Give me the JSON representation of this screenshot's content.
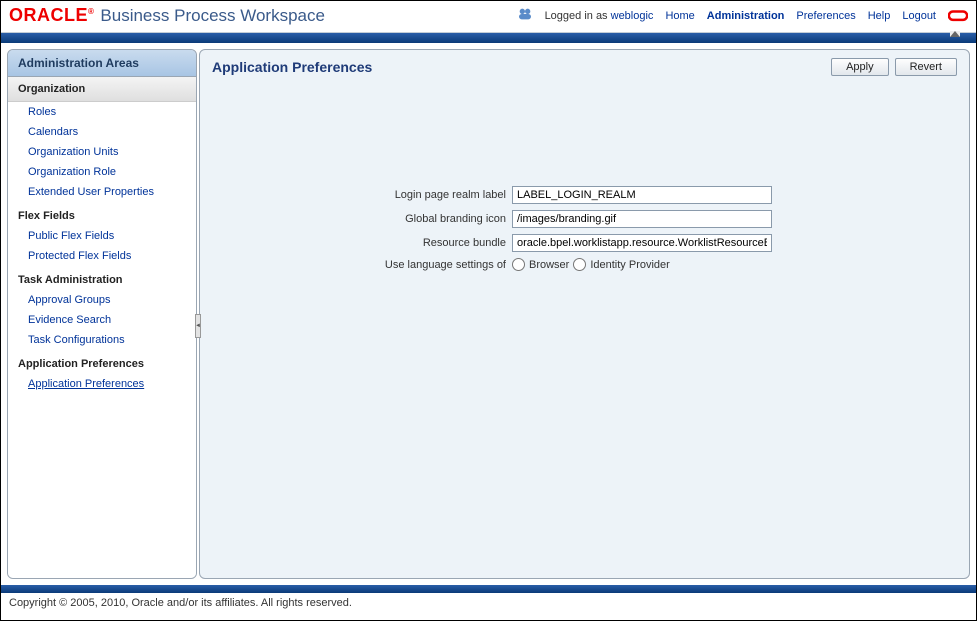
{
  "brand": {
    "oracle": "ORACLE",
    "reg": "®",
    "title": "Business Process Workspace"
  },
  "header": {
    "logged_in_prefix": "Logged in as ",
    "user": "weblogic",
    "home": "Home",
    "administration": "Administration",
    "preferences": "Preferences",
    "help": "Help",
    "logout": "Logout"
  },
  "sidebar": {
    "title": "Administration Areas",
    "groups": [
      {
        "head": "Organization",
        "items": [
          "Roles",
          "Calendars",
          "Organization Units",
          "Organization Role",
          "Extended User Properties"
        ]
      },
      {
        "head": "Flex Fields",
        "items": [
          "Public Flex Fields",
          "Protected Flex Fields"
        ]
      },
      {
        "head": "Task Administration",
        "items": [
          "Approval Groups",
          "Evidence Search",
          "Task Configurations"
        ]
      },
      {
        "head": "Application Preferences",
        "items": [
          "Application Preferences"
        ]
      }
    ]
  },
  "main": {
    "title": "Application Preferences",
    "apply": "Apply",
    "revert": "Revert",
    "labels": {
      "login_realm": "Login page realm label",
      "branding_icon": "Global branding icon",
      "resource_bundle": "Resource bundle",
      "lang_settings": "Use language settings of"
    },
    "values": {
      "login_realm": "LABEL_LOGIN_REALM",
      "branding_icon": "/images/branding.gif",
      "resource_bundle": "oracle.bpel.worklistapp.resource.WorklistResourceBundle"
    },
    "radios": {
      "browser": "Browser",
      "idp": "Identity Provider"
    }
  },
  "footer": "Copyright © 2005, 2010, Oracle and/or its affiliates. All rights reserved."
}
